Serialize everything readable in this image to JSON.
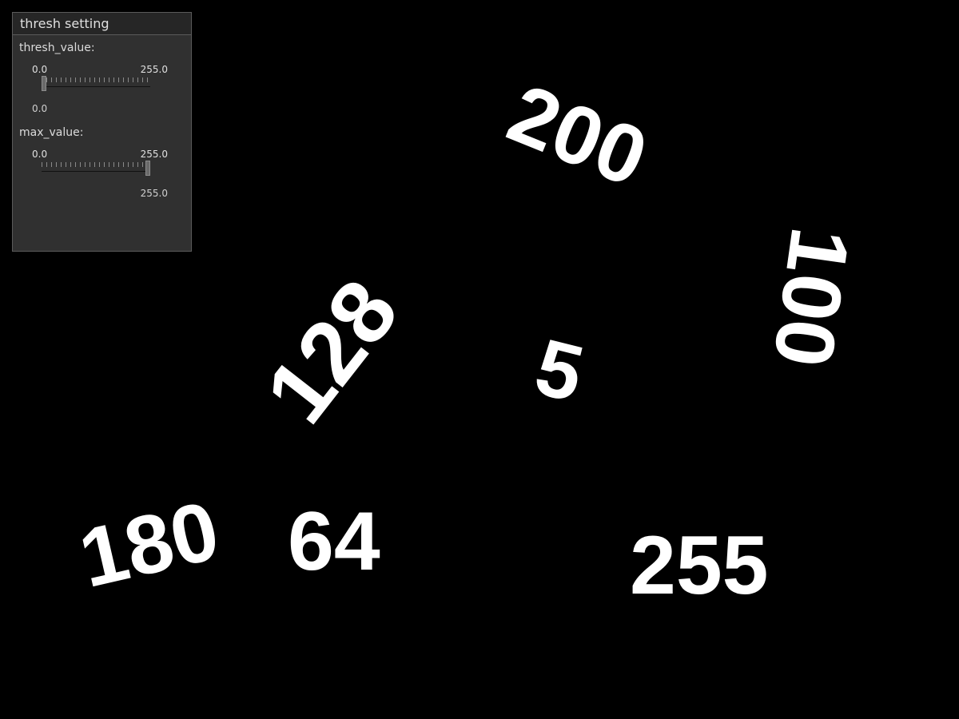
{
  "numbers": {
    "n200": "200",
    "n100": "100",
    "n128": "128",
    "n5": "5",
    "n180": "180",
    "n64": "64",
    "n255": "255"
  },
  "panel": {
    "title": "thresh setting",
    "trackbars": [
      {
        "label": "thresh_value:",
        "min": "0.0",
        "max": "255.0",
        "current": "0.0",
        "fraction": 0.0
      },
      {
        "label": "max_value:",
        "min": "0.0",
        "max": "255.0",
        "current": "255.0",
        "fraction": 1.0
      }
    ]
  },
  "colors": {
    "background": "#000000",
    "digits": "#ffffff",
    "panel_bg": "#303030"
  }
}
